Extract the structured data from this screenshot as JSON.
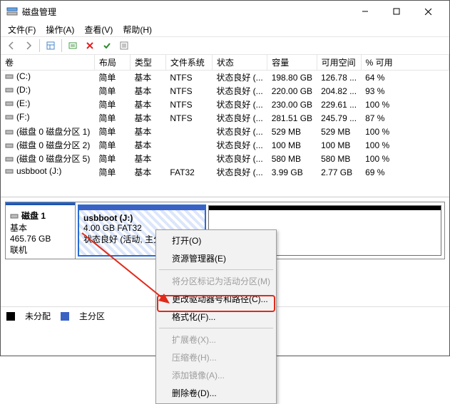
{
  "title": "磁盘管理",
  "menu": {
    "file": "文件(F)",
    "action": "操作(A)",
    "view": "查看(V)",
    "help": "帮助(H)"
  },
  "headers": {
    "vol": "卷",
    "layout": "布局",
    "type": "类型",
    "fs": "文件系统",
    "status": "状态",
    "cap": "容量",
    "free": "可用空间",
    "pct": "% 可用"
  },
  "rows": [
    {
      "vol": "(C:)",
      "layout": "简单",
      "type": "基本",
      "fs": "NTFS",
      "status": "状态良好 (...",
      "cap": "198.80 GB",
      "free": "126.78 ...",
      "pct": "64 %"
    },
    {
      "vol": "(D:)",
      "layout": "简单",
      "type": "基本",
      "fs": "NTFS",
      "status": "状态良好 (...",
      "cap": "220.00 GB",
      "free": "204.82 ...",
      "pct": "93 %"
    },
    {
      "vol": "(E:)",
      "layout": "简单",
      "type": "基本",
      "fs": "NTFS",
      "status": "状态良好 (...",
      "cap": "230.00 GB",
      "free": "229.61 ...",
      "pct": "100 %"
    },
    {
      "vol": "(F:)",
      "layout": "简单",
      "type": "基本",
      "fs": "NTFS",
      "status": "状态良好 (...",
      "cap": "281.51 GB",
      "free": "245.79 ...",
      "pct": "87 %"
    },
    {
      "vol": "(磁盘 0 磁盘分区 1)",
      "layout": "简单",
      "type": "基本",
      "fs": "",
      "status": "状态良好 (...",
      "cap": "529 MB",
      "free": "529 MB",
      "pct": "100 %"
    },
    {
      "vol": "(磁盘 0 磁盘分区 2)",
      "layout": "简单",
      "type": "基本",
      "fs": "",
      "status": "状态良好 (...",
      "cap": "100 MB",
      "free": "100 MB",
      "pct": "100 %"
    },
    {
      "vol": "(磁盘 0 磁盘分区 5)",
      "layout": "简单",
      "type": "基本",
      "fs": "",
      "status": "状态良好 (...",
      "cap": "580 MB",
      "free": "580 MB",
      "pct": "100 %"
    },
    {
      "vol": "usbboot (J:)",
      "layout": "简单",
      "type": "基本",
      "fs": "FAT32",
      "status": "状态良好 (...",
      "cap": "3.99 GB",
      "free": "2.77 GB",
      "pct": "69 %"
    }
  ],
  "disk": {
    "name": "磁盘 1",
    "type": "基本",
    "size": "465.76 GB",
    "status": "联机"
  },
  "part1": {
    "name": "usbboot  (J:)",
    "line2": "4.00 GB FAT32",
    "line3": "状态良好 (活动, 主分区"
  },
  "ctx": {
    "open": "打开(O)",
    "explorer": "资源管理器(E)",
    "markactive": "将分区标记为活动分区(M)",
    "changeletter": "更改驱动器号和路径(C)...",
    "format": "格式化(F)...",
    "extend": "扩展卷(X)...",
    "shrink": "压缩卷(H)...",
    "mirror": "添加镜像(A)...",
    "delete": "删除卷(D)..."
  },
  "legend": {
    "unalloc": "未分配",
    "primary": "主分区"
  }
}
